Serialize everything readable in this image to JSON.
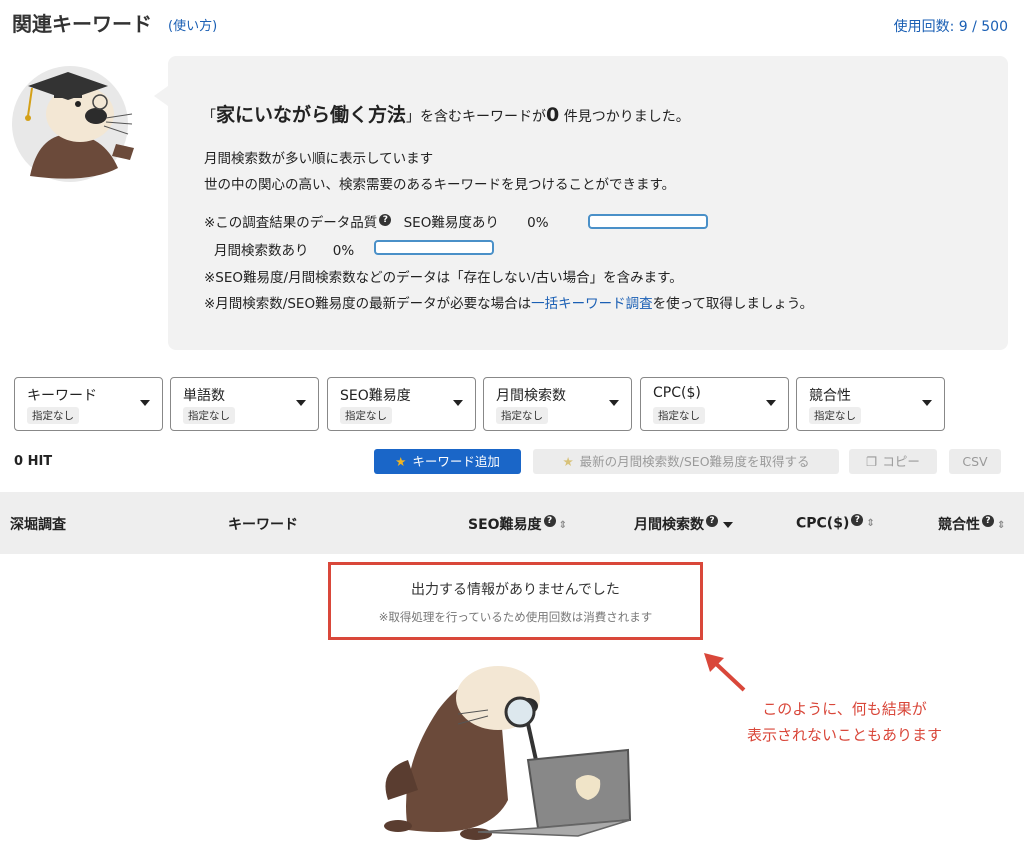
{
  "header": {
    "title": "関連キーワード",
    "help_link": "(使い方)",
    "usage": "使用回数: 9 / 500"
  },
  "info": {
    "result_prefix": "「",
    "keyword": "家にいながら働く方法",
    "result_suffix_1": "」を含むキーワードが",
    "result_count": "0",
    "result_suffix_2": "件見つかりました。",
    "line1": "月間検索数が多い順に表示しています",
    "line2": "世の中の関心の高い、検索需要のあるキーワードを見つけることができます。",
    "quality_label": "※この調査結果のデータ品質",
    "seo_label": "SEO難易度あり",
    "seo_pct": "0%",
    "seo_value": 0,
    "volume_label": "月間検索数あり",
    "volume_pct": "0%",
    "volume_value": 0,
    "note1": "※SEO難易度/月間検索数などのデータは「存在しない/古い場合」を含みます。",
    "note2_prefix": "※月間検索数/SEO難易度の最新データが必要な場合は",
    "note2_link": "一括キーワード調査",
    "note2_suffix": "を使って取得しましょう。",
    "help_badge": "?"
  },
  "filters": [
    {
      "label": "キーワード",
      "value": "指定なし"
    },
    {
      "label": "単語数",
      "value": "指定なし"
    },
    {
      "label": "SEO難易度",
      "value": "指定なし"
    },
    {
      "label": "月間検索数",
      "value": "指定なし"
    },
    {
      "label": "CPC($)",
      "value": "指定なし"
    },
    {
      "label": "競合性",
      "value": "指定なし"
    }
  ],
  "toolbar": {
    "hit_count": "0 HIT",
    "add_keyword": "キーワード追加",
    "fetch_latest": "最新の月間検索数/SEO難易度を取得する",
    "copy": "コピー",
    "csv": "CSV"
  },
  "table": {
    "columns": [
      "深堀調査",
      "キーワード",
      "SEO難易度",
      "月間検索数",
      "CPC($)",
      "競合性"
    ]
  },
  "empty": {
    "title": "出力する情報がありませんでした",
    "note": "※取得処理を行っているため使用回数は消費されます"
  },
  "annotation": {
    "line1": "このように、何も結果が",
    "line2": "表示されないこともあります"
  },
  "colors": {
    "accent": "#1a66c8",
    "annotation": "#d9473a",
    "panel_bg": "#f2f2f2"
  }
}
